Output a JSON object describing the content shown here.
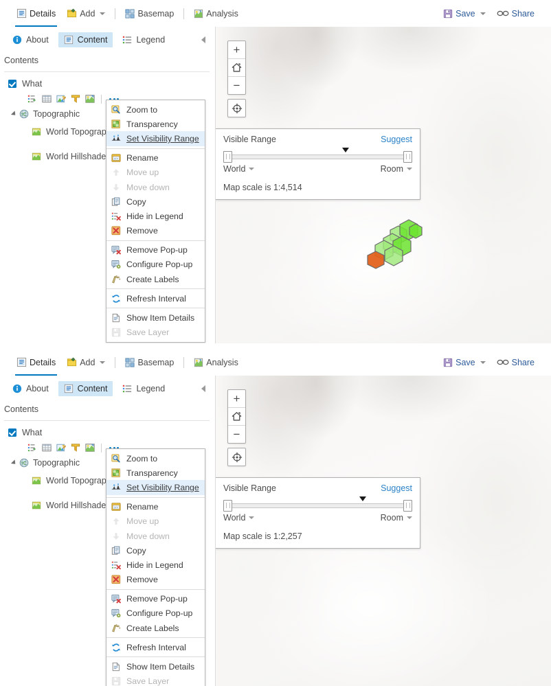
{
  "toolbar": {
    "details_label": "Details",
    "add_label": "Add",
    "basemap_label": "Basemap",
    "analysis_label": "Analysis",
    "save_label": "Save",
    "share_label": "Share",
    "icons": {
      "details": "details-icon",
      "add": "add-icon",
      "basemap": "basemap-icon",
      "analysis": "analysis-icon",
      "save": "save-icon",
      "share": "share-icon"
    }
  },
  "sidebar": {
    "tabs": [
      {
        "label": "About",
        "icon": "info-icon",
        "selected": false
      },
      {
        "label": "Content",
        "icon": "content-icon",
        "selected": true
      },
      {
        "label": "Legend",
        "icon": "legend-icon",
        "selected": false
      }
    ],
    "contents_label": "Contents",
    "tree": {
      "root": {
        "label": "What",
        "checked": true
      },
      "layer_tools": [
        "show-table-icon",
        "table-icon",
        "change-style-icon",
        "filter-icon",
        "symbology-icon",
        "more-options-icon"
      ],
      "group": {
        "label": "Topographic",
        "icon": "basemap-globe-icon",
        "expanded": true
      },
      "children": [
        {
          "label": "World Topograp",
          "icon": "layer-tile-icon"
        },
        {
          "label": "World Hillshade",
          "icon": "layer-tile-icon"
        }
      ]
    }
  },
  "context_menu": {
    "groups": [
      [
        {
          "label": "Zoom to",
          "icon": "zoom-to-icon",
          "disabled": false,
          "highlighted": false
        },
        {
          "label": "Transparency",
          "icon": "transparency-icon",
          "disabled": false,
          "highlighted": false
        },
        {
          "label": "Set Visibility Range",
          "icon": "visibility-range-icon",
          "disabled": false,
          "highlighted": true
        }
      ],
      [
        {
          "label": "Rename",
          "icon": "rename-icon",
          "disabled": false,
          "highlighted": false
        },
        {
          "label": "Move up",
          "icon": "arrow-up-icon",
          "disabled": true,
          "highlighted": false
        },
        {
          "label": "Move down",
          "icon": "arrow-down-icon",
          "disabled": true,
          "highlighted": false
        },
        {
          "label": "Copy",
          "icon": "copy-icon",
          "disabled": false,
          "highlighted": false
        },
        {
          "label": "Hide in Legend",
          "icon": "hide-legend-icon",
          "disabled": false,
          "highlighted": false
        },
        {
          "label": "Remove",
          "icon": "remove-icon",
          "disabled": false,
          "highlighted": false
        }
      ],
      [
        {
          "label": "Remove Pop-up",
          "icon": "remove-popup-icon",
          "disabled": false,
          "highlighted": false
        },
        {
          "label": "Configure Pop-up",
          "icon": "configure-popup-icon",
          "disabled": false,
          "highlighted": false
        },
        {
          "label": "Create Labels",
          "icon": "create-labels-icon",
          "disabled": false,
          "highlighted": false
        }
      ],
      [
        {
          "label": "Refresh Interval",
          "icon": "refresh-icon",
          "disabled": false,
          "highlighted": false
        }
      ],
      [
        {
          "label": "Show Item Details",
          "icon": "item-details-icon",
          "disabled": false,
          "highlighted": false
        },
        {
          "label": "Save Layer",
          "icon": "save-layer-icon",
          "disabled": true,
          "highlighted": false
        }
      ]
    ]
  },
  "map_widgets": {
    "zoom_in": "+",
    "home": "home-icon",
    "zoom_out": "−",
    "locate": "locate-icon"
  },
  "panels": [
    {
      "id": "panel-1",
      "visible_range": {
        "title": "Visible Range",
        "suggest_label": "Suggest",
        "min_label": "World",
        "max_label": "Room",
        "scale_text": "Map scale is 1:4,514",
        "marker_percent": 63
      },
      "graphics": {
        "visible": true,
        "fill_green": "#6ee331",
        "fill_light_green": "#9fe87a",
        "fill_orange": "#e2621c",
        "outline": "#6b6b6b"
      }
    },
    {
      "id": "panel-2",
      "visible_range": {
        "title": "Visible Range",
        "suggest_label": "Suggest",
        "min_label": "World",
        "max_label": "Room",
        "scale_text": "Map scale is 1:2,257",
        "marker_percent": 72
      },
      "graphics": {
        "visible": false,
        "fill_green": "#6ee331",
        "fill_light_green": "#9fe87a",
        "fill_orange": "#e2621c",
        "outline": "#6b6b6b"
      }
    }
  ],
  "colors": {
    "accent": "#0079c1",
    "link": "#2b82c8",
    "highlight_bg": "#e3effa",
    "tab_selected_bg": "#cfe6f7"
  }
}
